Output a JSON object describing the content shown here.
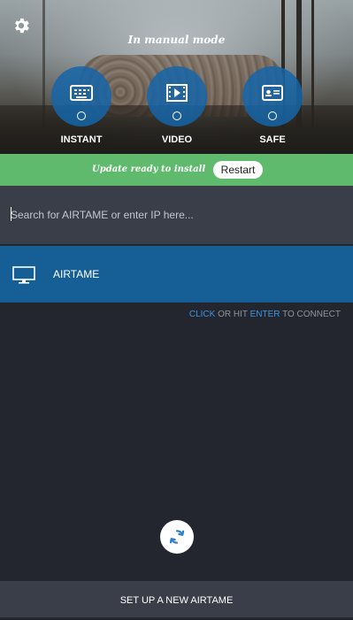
{
  "header": {
    "mode_text": "In manual mode",
    "modes": [
      {
        "label": "INSTANT",
        "icon": "keyboard-icon"
      },
      {
        "label": "VIDEO",
        "icon": "video-icon"
      },
      {
        "label": "SAFE",
        "icon": "card-icon"
      }
    ]
  },
  "update": {
    "message": "Update ready to install",
    "button_label": "Restart"
  },
  "search": {
    "placeholder": "Search for AIRTAME or enter IP here..."
  },
  "devices": [
    {
      "name": "AIRTAME",
      "icon": "monitor-icon"
    }
  ],
  "hint": {
    "part1": "CLICK",
    "part2": " OR HIT ",
    "part3": "ENTER",
    "part4": " TO CONNECT"
  },
  "footer": {
    "setup_label": "SET UP A NEW AIRTAME"
  },
  "colors": {
    "accent_blue": "#155f96",
    "update_green": "#5fba6d",
    "background": "#23262e",
    "link_blue": "#3e94e0"
  }
}
